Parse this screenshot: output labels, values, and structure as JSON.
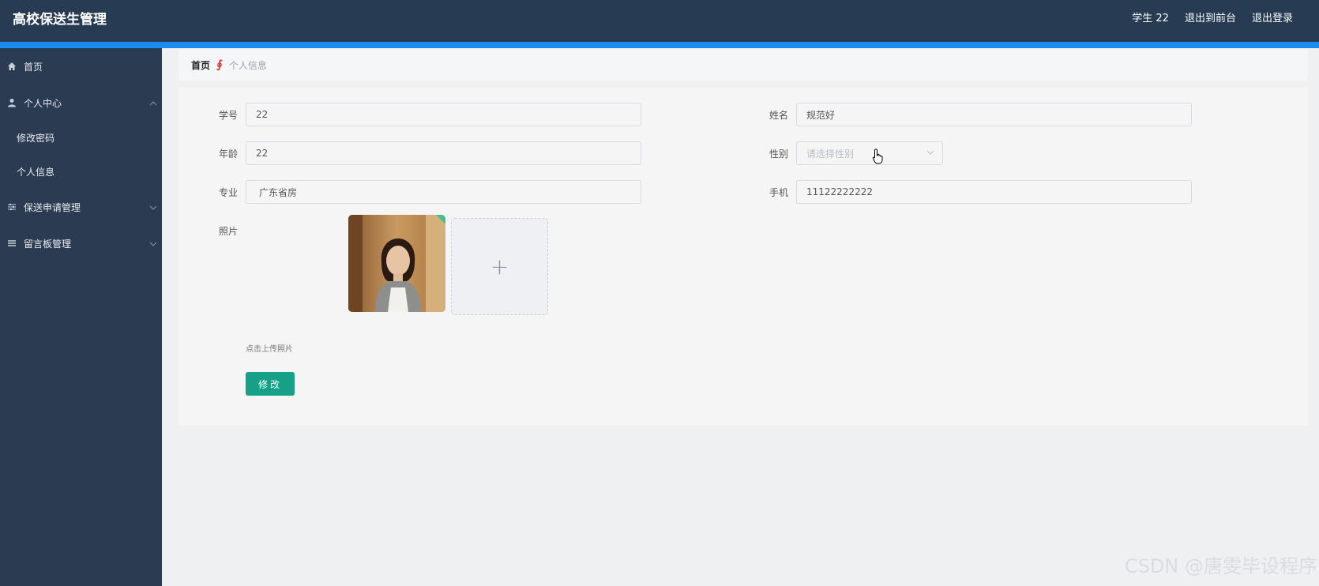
{
  "header": {
    "app_title": "高校保送生管理",
    "user_label": "学生 22",
    "exit_frontend": "退出到前台",
    "logout": "退出登录"
  },
  "sidebar": {
    "items": [
      {
        "label": "首页",
        "icon": "home-icon"
      },
      {
        "label": "个人中心",
        "icon": "user-icon",
        "expanded": true,
        "children": [
          {
            "label": "修改密码"
          },
          {
            "label": "个人信息"
          }
        ]
      },
      {
        "label": "保送申请管理",
        "icon": "sliders-icon"
      },
      {
        "label": "留言板管理",
        "icon": "list-icon"
      }
    ]
  },
  "breadcrumb": {
    "home": "首页",
    "separator": "∮",
    "current": "个人信息"
  },
  "form": {
    "student_no": {
      "label": "学号",
      "value": "22"
    },
    "name": {
      "label": "姓名",
      "value": "规范好"
    },
    "age": {
      "label": "年龄",
      "value": "22"
    },
    "gender": {
      "label": "性别",
      "placeholder": "请选择性别"
    },
    "major": {
      "label": "专业",
      "value": "广东省房"
    },
    "phone": {
      "label": "手机",
      "value": "11122222222"
    },
    "photo": {
      "label": "照片",
      "upload_tip": "点击上传照片",
      "add_symbol": "+"
    },
    "submit_label": "修改"
  },
  "watermark": "CSDN @唐雯毕设程序",
  "colors": {
    "header_bg": "#273b52",
    "accent_blue": "#1a8cf0",
    "sidebar_bg": "#2b3c52",
    "button": "#16a088"
  }
}
